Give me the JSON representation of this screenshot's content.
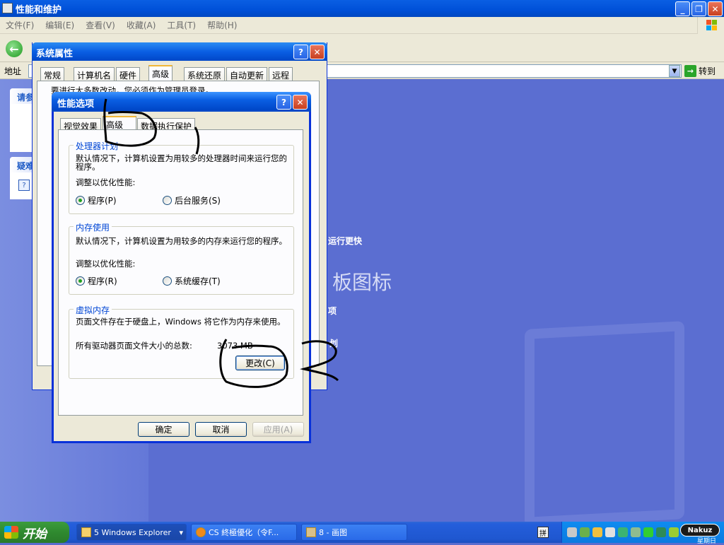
{
  "explorer": {
    "title": "性能和维护",
    "menu": [
      "文件(F)",
      "编辑(E)",
      "查看(V)",
      "收藏(A)",
      "工具(T)",
      "帮助(H)"
    ],
    "back_label": "后退",
    "address_label": "地址",
    "go_label": "转到",
    "side_heading_1": "请参",
    "side_heading_2": "疑难",
    "bg_text_1": "运行更快",
    "bg_text_2": "板图标",
    "bg_text_3": "项",
    "bg_text_4": "划"
  },
  "system_properties": {
    "title": "系统属性",
    "tabs": [
      "常规",
      "计算机名",
      "硬件",
      "高级",
      "系统还原",
      "自动更新",
      "远程"
    ],
    "notice": "要进行大多数改动，您必须作为管理员登录。"
  },
  "performance_options": {
    "title": "性能选项",
    "tabs": [
      "视觉效果",
      "高级",
      "数据执行保护"
    ],
    "processor": {
      "label": "处理器计划",
      "desc": "默认情况下，计算机设置为用较多的处理器时间来运行您的程序。",
      "adjust": "调整以优化性能:",
      "opt1": "程序(P)",
      "opt2": "后台服务(S)"
    },
    "memory": {
      "label": "内存使用",
      "desc": "默认情况下，计算机设置为用较多的内存来运行您的程序。",
      "adjust": "调整以优化性能:",
      "opt1": "程序(R)",
      "opt2": "系统缓存(T)"
    },
    "virtual": {
      "label": "虚拟内存",
      "desc": "页面文件存在于硬盘上，Windows 将它作为内存来使用。",
      "total_label": "所有驱动器页面文件大小的总数:",
      "total_value": "3073 MB",
      "change_button": "更改(C)"
    },
    "ok": "确定",
    "cancel": "取消",
    "apply": "应用(A)"
  },
  "taskbar": {
    "start": "开始",
    "tasks": [
      "5 Windows Explorer",
      "CS 終極優化（令F...",
      "8 - 画图"
    ],
    "lang": "拼",
    "tray_brand": "Nakuz",
    "tray_clock": "星期日"
  }
}
